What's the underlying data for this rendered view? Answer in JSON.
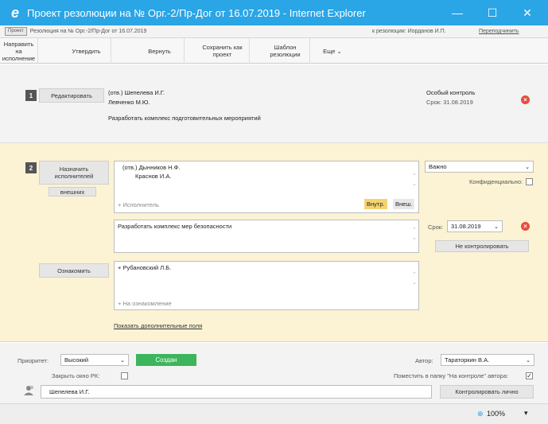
{
  "window": {
    "title": "Проект резолюции на № Орг.-2/Пр-Дог от 16.07.2019 - Internet Explorer",
    "minimize_icon": "—",
    "maximize_icon": "☐",
    "close_icon": "✕"
  },
  "header": {
    "badge": "Проект",
    "document": "Резолюция на № Орг.-2/Пр-Дог от 16.07.2019",
    "to_resolution": "к резолюции: Иорданов И.П.",
    "reassign": "Переподчинить"
  },
  "toolbar": {
    "send_for_execution": "Направить на исполнение",
    "approve": "Утвердить",
    "return": "Вернуть",
    "save_as_draft": "Сохранить как проект",
    "resolution_template": "Шаблон резолюции",
    "more": "Еще ⌄"
  },
  "section1": {
    "number": "1",
    "edit_button": "Редактировать",
    "executor_1": "(отв.) Шепелева И.Г.",
    "executor_2": "Левченко М.Ю.",
    "task": "Разработать комплекс подготовительных мероприятий",
    "special_control": "Особый контроль",
    "deadline": "Срок: 31.08.2019",
    "remove_icon": "×"
  },
  "section2": {
    "number": "2",
    "assign_executors_button": "Назначить исполнителей",
    "external_button": "внешних",
    "executor_1": "(отв.) Дынников Н.Ф.",
    "executor_2": "Краснов И.А.",
    "add_executor": "+ Исполнитель",
    "internal_tab": "Внутр.",
    "external_tab": "Внеш.",
    "importance": "Важно",
    "confidential_label": "Конфиденциально:",
    "task": "Разработать комплекс мер безопасности",
    "deadline_label": "Срок:",
    "deadline_value": "31.08.2019",
    "do_not_control": "Не контролировать",
    "familiarize_button": "Ознакомить",
    "familiarize_person": "+ Рубановский Л.Б.",
    "add_familiarization": "+ На ознакомление",
    "show_extra_fields": "Показать дополнительные поля",
    "remove_icon": "×"
  },
  "bottom": {
    "priority_label": "Приоритет:",
    "priority_value": "Высокий",
    "status_button": "Создан",
    "close_window_label": "Закрыть окно РК:",
    "author_label": "Автор:",
    "author_value": "Тараторкин В.А.",
    "place_in_folder_label": "Поместить в папку \"На контроле\" автора:",
    "checked_mark": "✓",
    "signer": "Шепелева И.Г.",
    "control_personally": "Контролировать лично"
  },
  "statusbar": {
    "zoom": "100%",
    "zoom_icon": "⊕"
  }
}
